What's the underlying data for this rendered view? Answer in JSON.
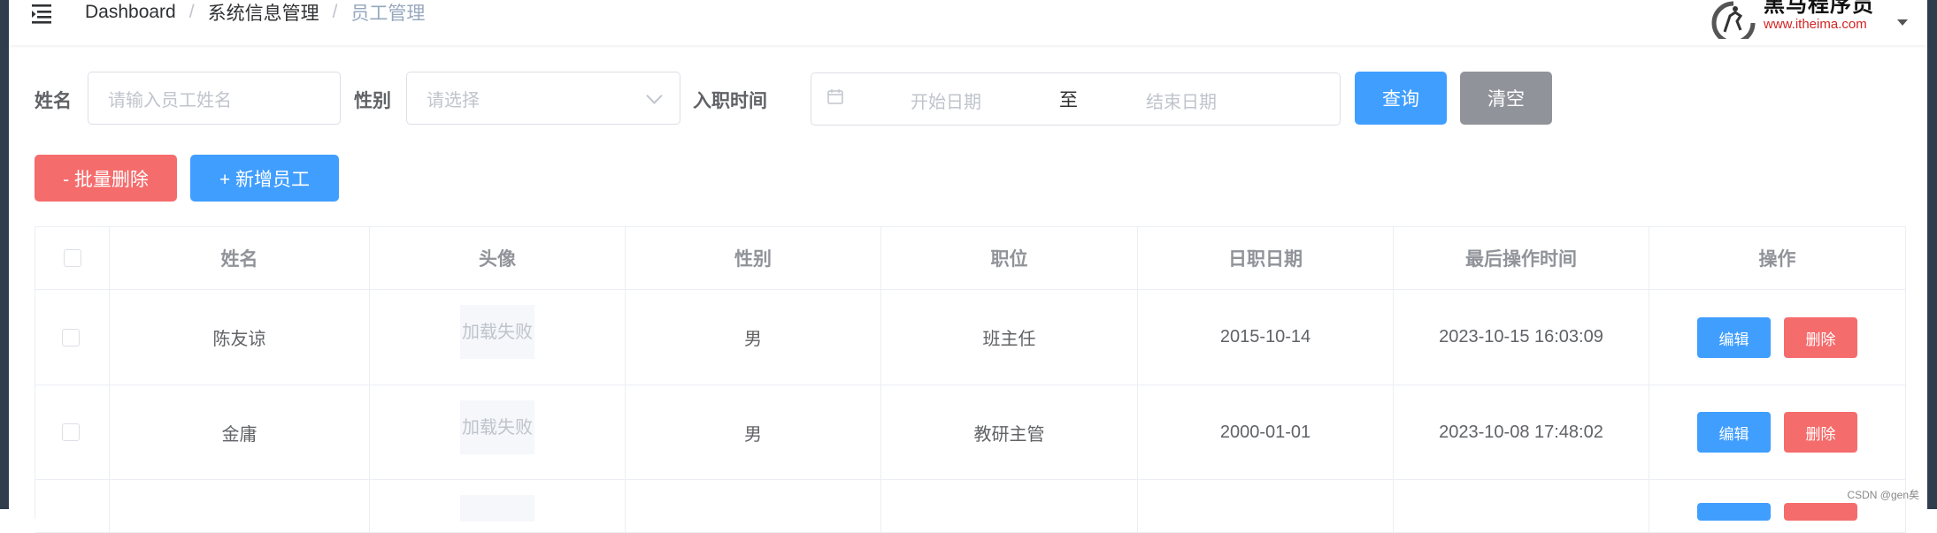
{
  "header": {
    "breadcrumb": [
      "Dashboard",
      "系统信息管理",
      "员工管理"
    ],
    "breadcrumb_separator": "/",
    "logo_text": "黑马程序员",
    "logo_url": "www.itheima.com"
  },
  "search": {
    "name_label": "姓名",
    "name_placeholder": "请输入员工姓名",
    "gender_label": "性别",
    "gender_placeholder": "请选择",
    "date_label": "入职时间",
    "start_placeholder": "开始日期",
    "range_separator": "至",
    "end_placeholder": "结束日期",
    "query_button": "查询",
    "clear_button": "清空"
  },
  "actions": {
    "batch_delete": "- 批量删除",
    "add_employee": "+ 新增员工"
  },
  "table": {
    "columns": [
      "姓名",
      "头像",
      "性别",
      "职位",
      "日职日期",
      "最后操作时间",
      "操作"
    ],
    "rows": [
      {
        "name": "陈友谅",
        "avatar": "加载失败",
        "gender": "男",
        "job": "班主任",
        "entry_date": "2015-10-14",
        "update_time": "2023-10-15 16:03:09",
        "edit": "编辑",
        "delete": "删除"
      },
      {
        "name": "金庸",
        "avatar": "加载失败",
        "gender": "男",
        "job": "教研主管",
        "entry_date": "2000-01-01",
        "update_time": "2023-10-08 17:48:02",
        "edit": "编辑",
        "delete": "删除"
      }
    ]
  },
  "watermark": "CSDN @gen矣",
  "colors": {
    "primary": "#409eff",
    "danger": "#f56c6c",
    "info": "#909399",
    "sidebar_dark": "#2f3d4d"
  }
}
